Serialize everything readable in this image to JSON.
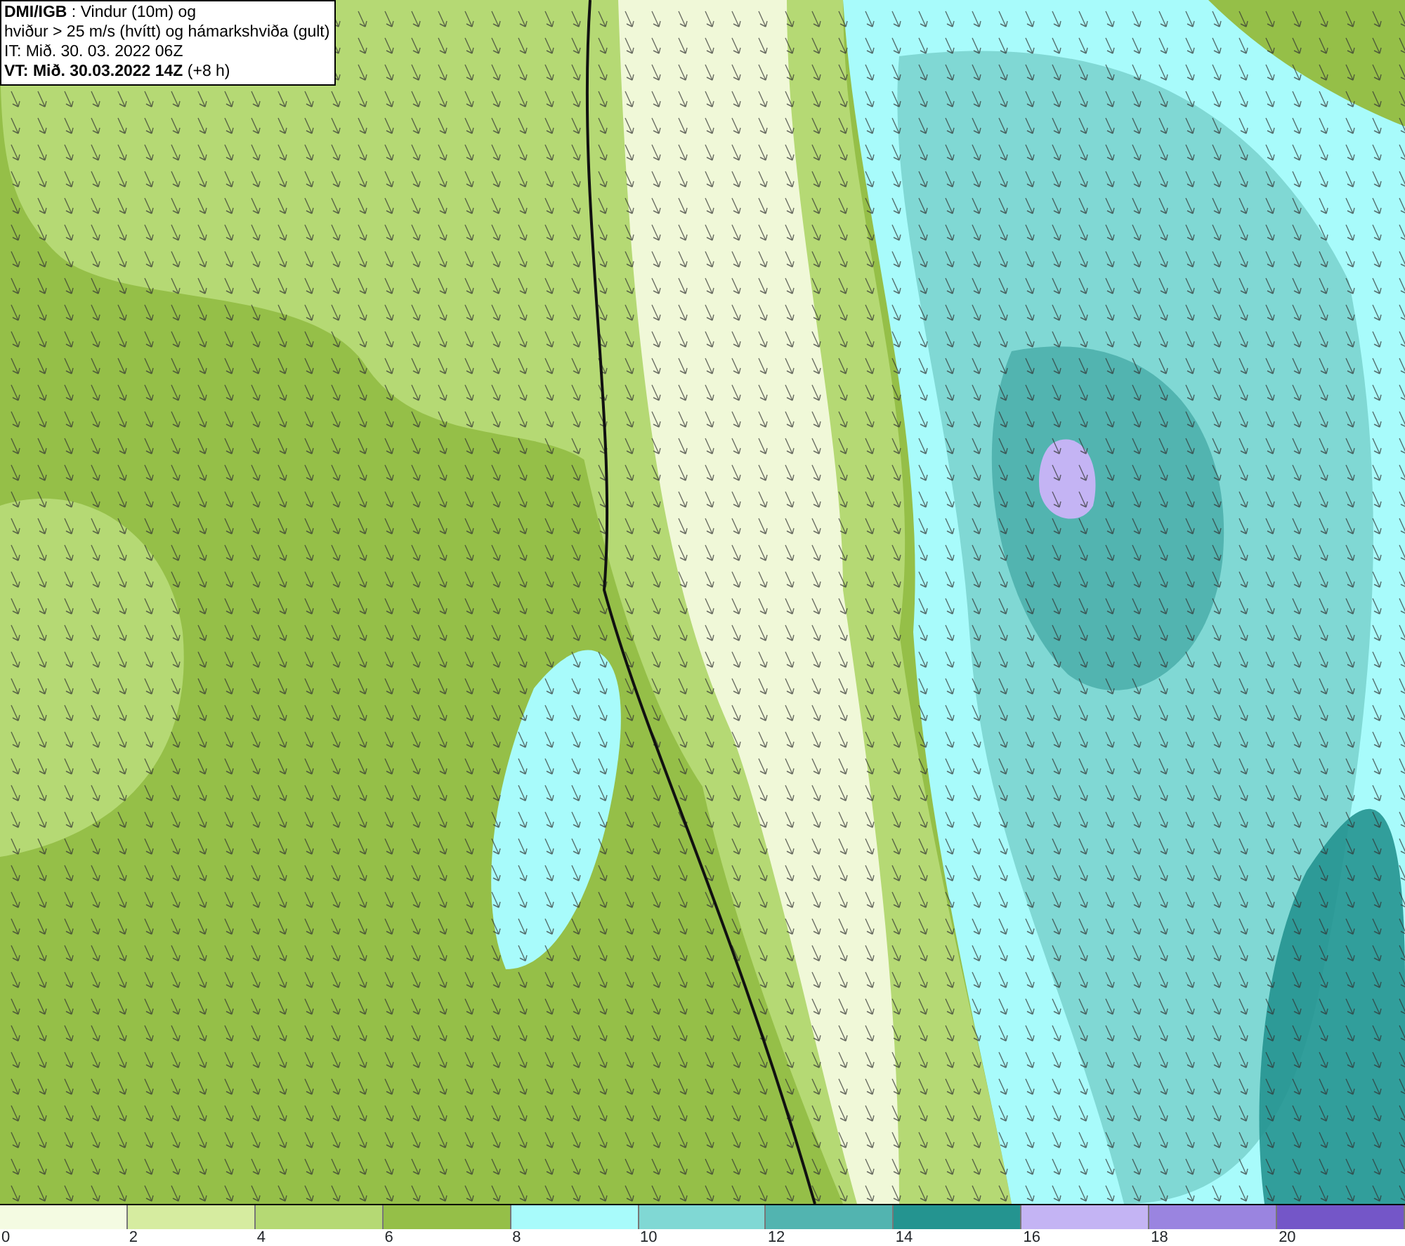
{
  "header": {
    "lines": [
      "**DMI/IGB** : Vindur (10m) og",
      "hviður > 25 m/s (hvítt) og hámarkshviða (gult)",
      "IT: Mið. 30. 03. 2022 06Z",
      "**VT: Mið. 30.03.2022 14Z** (+8 h)"
    ]
  },
  "legend": {
    "bins": [
      {
        "color": "#f4fbe2"
      },
      {
        "color": "#d6eca0"
      },
      {
        "color": "#b5d974"
      },
      {
        "color": "#95bf48"
      },
      {
        "color": "#a8fbfb"
      },
      {
        "color": "#80d8d4"
      },
      {
        "color": "#52b4b0"
      },
      {
        "color": "#249490"
      },
      {
        "color": "#c4b4f4"
      },
      {
        "color": "#9a84e0"
      },
      {
        "color": "#7456c8"
      }
    ],
    "labels": [
      "0",
      "2",
      "4",
      "6",
      "8",
      "10",
      "12",
      "14",
      "16",
      "18",
      "20"
    ]
  }
}
